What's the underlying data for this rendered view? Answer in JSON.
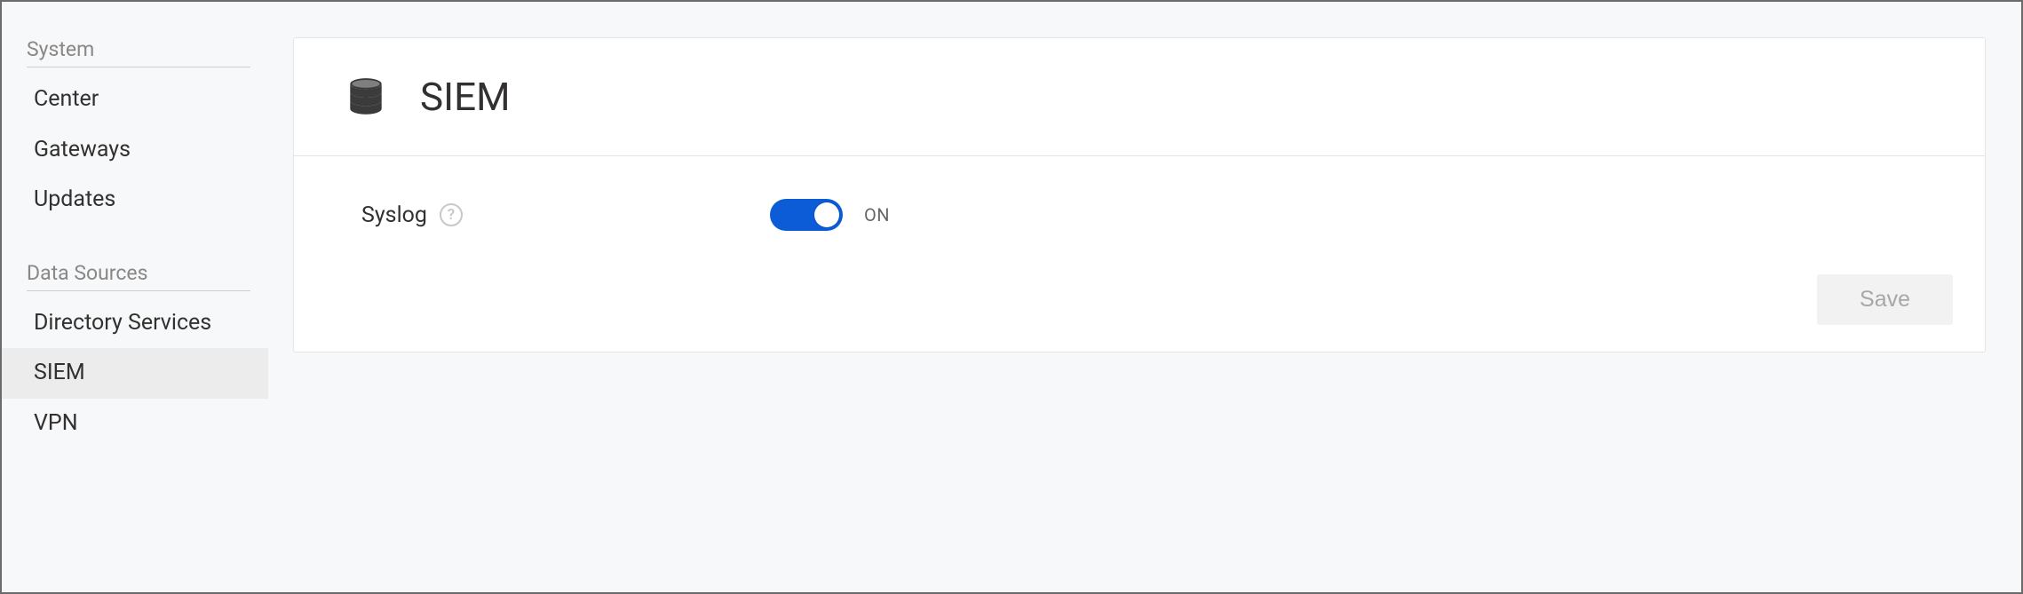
{
  "sidebar": {
    "groups": [
      {
        "heading": "System",
        "items": [
          {
            "label": "Center",
            "active": false
          },
          {
            "label": "Gateways",
            "active": false
          },
          {
            "label": "Updates",
            "active": false
          }
        ]
      },
      {
        "heading": "Data Sources",
        "items": [
          {
            "label": "Directory Services",
            "active": false
          },
          {
            "label": "SIEM",
            "active": true
          },
          {
            "label": "VPN",
            "active": false
          }
        ]
      }
    ]
  },
  "page": {
    "title": "SIEM",
    "icon": "database-icon"
  },
  "settings": {
    "syslog": {
      "label": "Syslog",
      "state_label": "ON",
      "value": true
    }
  },
  "actions": {
    "save_label": "Save",
    "save_enabled": false
  },
  "colors": {
    "accent": "#0b5cd6",
    "panel_border": "#e5e5e5",
    "muted_text": "#8a8886"
  }
}
